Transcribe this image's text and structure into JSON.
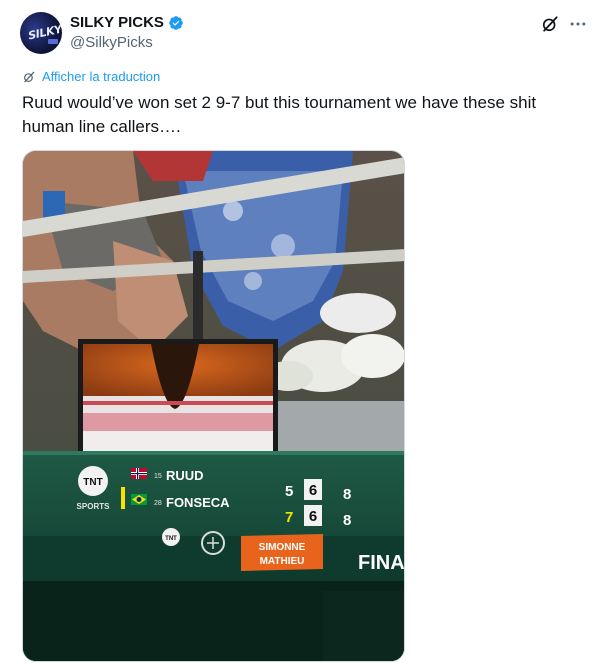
{
  "author": {
    "display_name": "SILKY PICKS",
    "handle": "@SilkyPicks",
    "verified": true,
    "avatar_icon": "silky-picks-logo"
  },
  "header_icons": {
    "grok": "grok-icon",
    "more": "more-icon"
  },
  "translate_label": "Afficher la traduction",
  "tweet_text": "Ruud would’ve won set 2 9-7 but this tournament we have these shit human line callers….",
  "scoreboard": {
    "broadcaster": "TNT",
    "broadcaster_sub": "SPORTS",
    "players": [
      {
        "seed": "15",
        "name": "RUUD",
        "flag": "norway",
        "sets": [
          "5",
          "6",
          "8"
        ],
        "serving": false
      },
      {
        "seed": "28",
        "name": "FONSECA",
        "flag": "brazil",
        "sets": [
          "7",
          "6",
          "8"
        ],
        "serving": true
      }
    ],
    "court_name_line1": "SIMONNE",
    "court_name_line2": "MATHIEU",
    "right_label": "FINA",
    "colors": {
      "accent": "#1d9bf0",
      "board_green": "#0f3a2c",
      "court_orange": "#e86b1c",
      "serve_yellow": "#f5e400"
    }
  }
}
